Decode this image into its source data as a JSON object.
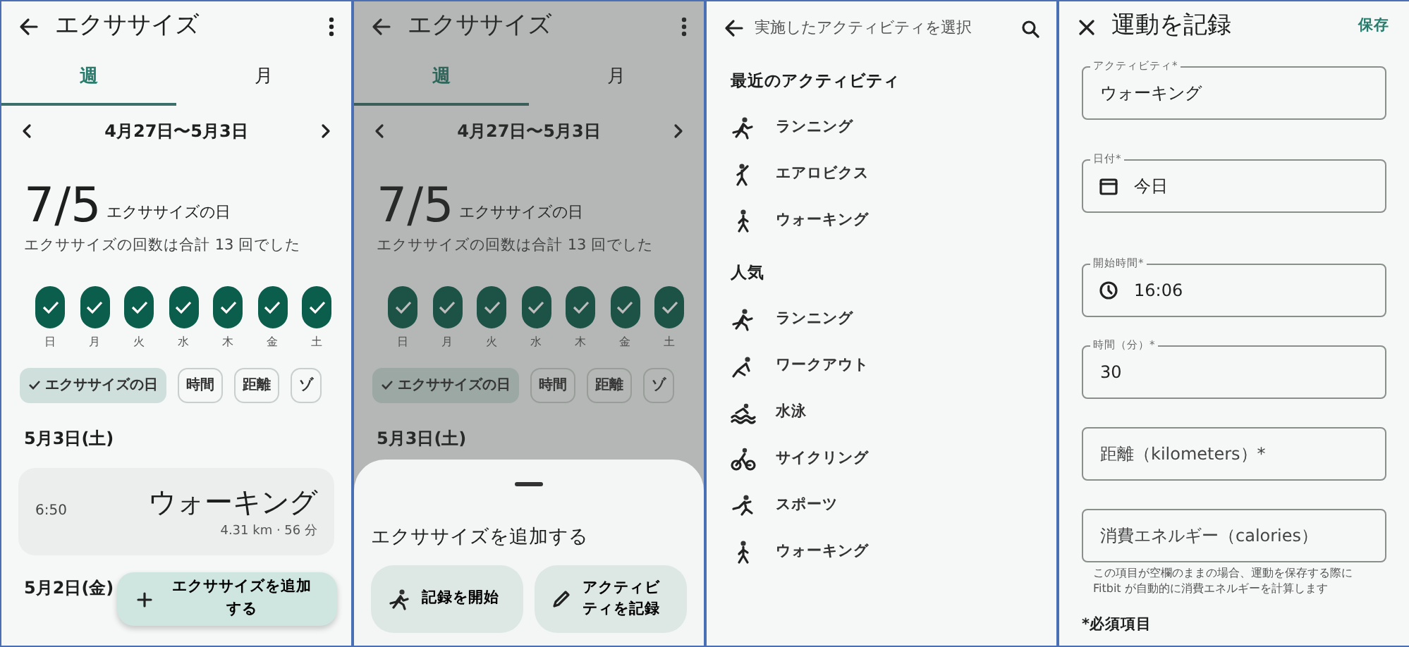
{
  "screens": [
    {
      "kind": "summary",
      "dimmed": false,
      "title": "エクササイズ",
      "tabs": [
        {
          "label": "週",
          "selected": true
        },
        {
          "label": "月",
          "selected": false
        }
      ],
      "range": "4月27日〜5月3日",
      "count": "7/5",
      "count_label": "エクササイズの日",
      "subtitle": "エクササイズの回数は合計 13 回でした",
      "days": [
        {
          "label": "日",
          "checked": true
        },
        {
          "label": "月",
          "checked": true
        },
        {
          "label": "火",
          "checked": true
        },
        {
          "label": "水",
          "checked": true
        },
        {
          "label": "木",
          "checked": true
        },
        {
          "label": "金",
          "checked": true
        },
        {
          "label": "土",
          "checked": true
        }
      ],
      "chips": [
        {
          "label": "エクササイズの日",
          "selected": true
        },
        {
          "label": "時間",
          "selected": false
        },
        {
          "label": "距離",
          "selected": false
        },
        {
          "label": "ゾ",
          "selected": false
        }
      ],
      "sections": [
        {
          "date": "5月3日(土)",
          "entries": [
            {
              "time": "6:50",
              "activity": "ウォーキング",
              "detail": "4.31 km · 56 分"
            }
          ]
        },
        {
          "date": "5月2日(金)"
        }
      ],
      "fab": "エクササイズを追加する"
    },
    {
      "kind": "summary",
      "dimmed": true,
      "title": "エクササイズ",
      "tabs": [
        {
          "label": "週",
          "selected": true
        },
        {
          "label": "月",
          "selected": false
        }
      ],
      "range": "4月27日〜5月3日",
      "count": "7/5",
      "count_label": "エクササイズの日",
      "subtitle": "エクササイズの回数は合計 13 回でした",
      "days": [
        {
          "label": "日",
          "checked": true
        },
        {
          "label": "月",
          "checked": true
        },
        {
          "label": "火",
          "checked": true
        },
        {
          "label": "水",
          "checked": true
        },
        {
          "label": "木",
          "checked": true
        },
        {
          "label": "金",
          "checked": true
        },
        {
          "label": "土",
          "checked": true
        }
      ],
      "chips": [
        {
          "label": "エクササイズの日",
          "selected": true
        },
        {
          "label": "時間",
          "selected": false
        },
        {
          "label": "距離",
          "selected": false
        },
        {
          "label": "ゾ",
          "selected": false
        }
      ],
      "sections": [
        {
          "date": "5月3日(土)"
        }
      ],
      "sheet": {
        "title": "エクササイズを追加する",
        "actions": [
          {
            "kind": "start",
            "label": "記録を開始"
          },
          {
            "kind": "log",
            "label": "アクティビティを記録"
          }
        ]
      }
    },
    {
      "kind": "picker",
      "title": "実施したアクティビティを選択",
      "groups": [
        {
          "heading": "最近のアクティビティ",
          "items": [
            {
              "kind": "run",
              "label": "ランニング"
            },
            {
              "kind": "aerobics",
              "label": "エアロビクス"
            },
            {
              "kind": "walk",
              "label": "ウォーキング"
            }
          ]
        },
        {
          "heading": "人気",
          "items": [
            {
              "kind": "run",
              "label": "ランニング"
            },
            {
              "kind": "workout",
              "label": "ワークアウト"
            },
            {
              "kind": "swim",
              "label": "水泳"
            },
            {
              "kind": "cycle",
              "label": "サイクリング"
            },
            {
              "kind": "sports",
              "label": "スポーツ"
            },
            {
              "kind": "walk",
              "label": "ウォーキング"
            }
          ]
        }
      ]
    },
    {
      "kind": "form",
      "title": "運動を記録",
      "save": "保存",
      "fields": [
        {
          "kind": "text",
          "label": "アクティビティ*",
          "value": "ウォーキング"
        },
        {
          "kind": "date",
          "label": "日付*",
          "value": "今日"
        },
        {
          "kind": "time",
          "label": "開始時間*",
          "value": "16:06"
        },
        {
          "kind": "text",
          "label": "時間（分）*",
          "value": "30"
        },
        {
          "kind": "text",
          "placeholder": "距離（kilometers）*"
        },
        {
          "kind": "text",
          "placeholder": "消費エネルギー（calories）",
          "help": "この項目が空欄のままの場合、運動を保存する際に Fitbit が自動的に消費エネルギーを計算します"
        }
      ],
      "note": "*必須項目"
    }
  ]
}
